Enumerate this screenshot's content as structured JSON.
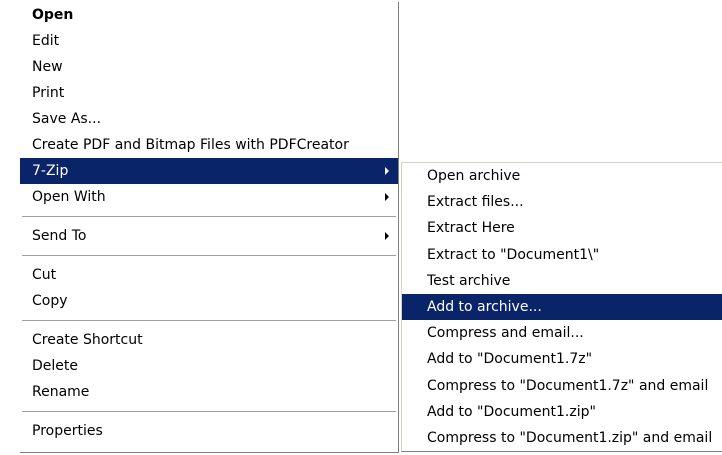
{
  "context_menu": {
    "items": [
      {
        "label": "Open"
      },
      {
        "label": "Edit"
      },
      {
        "label": "New"
      },
      {
        "label": "Print"
      },
      {
        "label": "Save As..."
      },
      {
        "label": "Create PDF and Bitmap Files with PDFCreator"
      },
      {
        "label": "7-Zip"
      },
      {
        "label": "Open With"
      },
      {
        "label": "Send To"
      },
      {
        "label": "Cut"
      },
      {
        "label": "Copy"
      },
      {
        "label": "Create Shortcut"
      },
      {
        "label": "Delete"
      },
      {
        "label": "Rename"
      },
      {
        "label": "Properties"
      }
    ],
    "selected_color": "#0a246a"
  },
  "submenu_7zip": {
    "items": [
      {
        "label": "Open archive"
      },
      {
        "label": "Extract files..."
      },
      {
        "label": "Extract Here"
      },
      {
        "label": "Extract to \"Document1\\\""
      },
      {
        "label": "Test archive"
      },
      {
        "label": "Add to archive..."
      },
      {
        "label": "Compress and email..."
      },
      {
        "label": "Add to \"Document1.7z\""
      },
      {
        "label": "Compress to \"Document1.7z\" and email"
      },
      {
        "label": "Add to \"Document1.zip\""
      },
      {
        "label": "Compress to \"Document1.zip\" and email"
      }
    ]
  }
}
